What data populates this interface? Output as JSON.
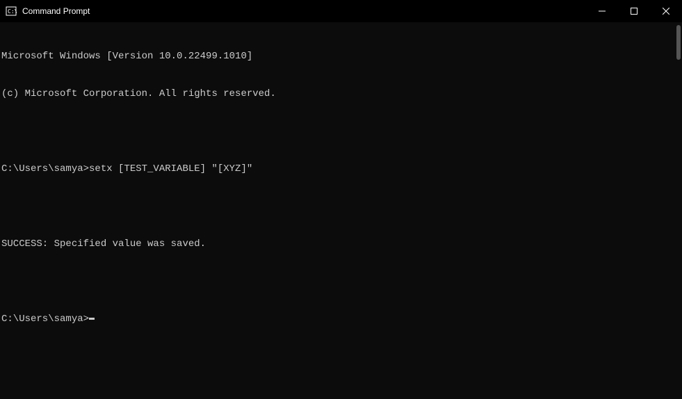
{
  "window": {
    "title": "Command Prompt"
  },
  "terminal": {
    "line1": "Microsoft Windows [Version 10.0.22499.1010]",
    "line2": "(c) Microsoft Corporation. All rights reserved.",
    "line3": "",
    "line4": "C:\\Users\\samya>setx [TEST_VARIABLE] \"[XYZ]\"",
    "line5": "",
    "line6": "SUCCESS: Specified value was saved.",
    "line7": "",
    "prompt": "C:\\Users\\samya>"
  }
}
